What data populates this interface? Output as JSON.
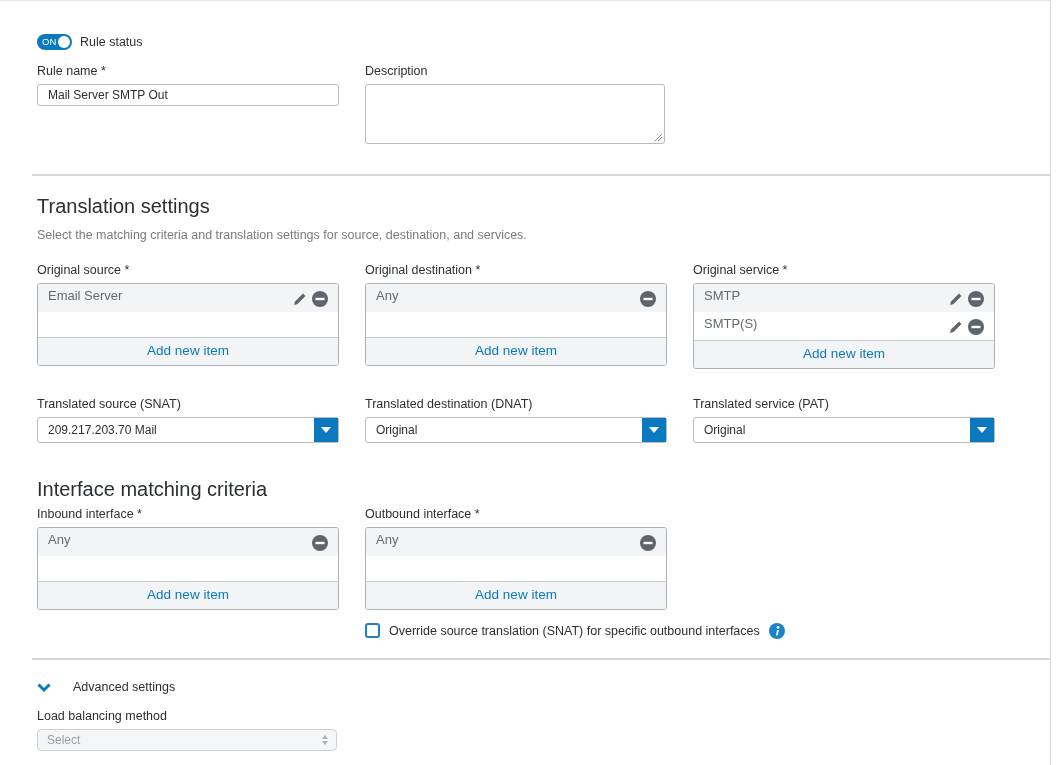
{
  "rule_status": {
    "label": "Rule status",
    "toggle_text": "ON",
    "on": true
  },
  "rule_name": {
    "label": "Rule name *",
    "value": "Mail Server SMTP Out"
  },
  "description": {
    "label": "Description"
  },
  "translation": {
    "title": "Translation settings",
    "subtitle": "Select the matching criteria and translation settings for source, destination, and services.",
    "original": [
      {
        "label": "Original source *",
        "items": [
          {
            "text": "Email Server",
            "editable": true
          }
        ],
        "add_label": "Add new item"
      },
      {
        "label": "Original destination *",
        "items": [
          {
            "text": "Any",
            "editable": false
          }
        ],
        "add_label": "Add new item"
      },
      {
        "label": "Original service *",
        "items": [
          {
            "text": "SMTP",
            "editable": true
          },
          {
            "text": "SMTP(S)",
            "editable": true
          }
        ],
        "add_label": "Add new item"
      }
    ],
    "translated": [
      {
        "label": "Translated source (SNAT)",
        "value": "209.217.203.70 Mail"
      },
      {
        "label": "Translated destination (DNAT)",
        "value": "Original"
      },
      {
        "label": "Translated service (PAT)",
        "value": "Original"
      }
    ]
  },
  "interface": {
    "title": "Interface matching criteria",
    "lists": [
      {
        "label": "Inbound interface *",
        "items": [
          {
            "text": "Any",
            "editable": false
          }
        ],
        "add_label": "Add new item"
      },
      {
        "label": "Outbound interface *",
        "items": [
          {
            "text": "Any",
            "editable": false
          }
        ],
        "add_label": "Add new item"
      }
    ],
    "override": {
      "label": "Override source translation (SNAT) for specific outbound interfaces",
      "checked": false
    }
  },
  "advanced": {
    "title": "Advanced settings",
    "expanded": true,
    "load_balancing": {
      "label": "Load balancing method",
      "placeholder": "Select",
      "disabled": true
    }
  }
}
